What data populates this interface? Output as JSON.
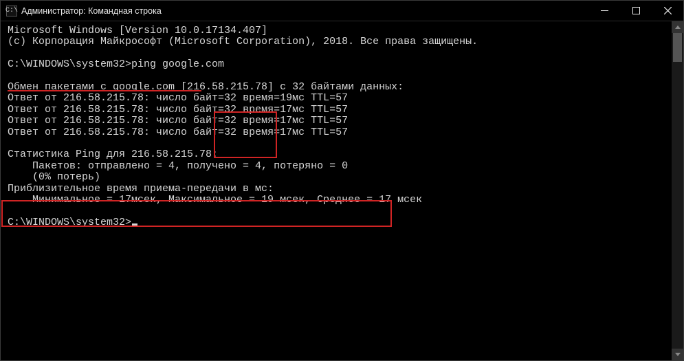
{
  "titlebar": {
    "icon_label": "C:\\",
    "title": "Администратор: Командная строка"
  },
  "window_controls": {
    "minimize": "minimize",
    "maximize": "maximize",
    "close": "close"
  },
  "console": {
    "line_win_version": "Microsoft Windows [Version 10.0.17134.407]",
    "line_copyright": "(c) Корпорация Майкрософт (Microsoft Corporation), 2018. Все права защищены.",
    "prompt1_prefix": "C:\\WINDOWS\\system32>",
    "prompt1_command": "ping google.com",
    "ping_header": "Обмен пакетами с google.com [216.58.215.78] с 32 байтами данных:",
    "replies": [
      {
        "prefix": "Ответ от 216.58.215.78: число байт=32 ",
        "time": "время=19мс",
        "suffix": " TTL=57"
      },
      {
        "prefix": "Ответ от 216.58.215.78: число байт=32 ",
        "time": "время=17мс",
        "suffix": " TTL=57"
      },
      {
        "prefix": "Ответ от 216.58.215.78: число байт=32 ",
        "time": "время=17мс",
        "suffix": " TTL=57"
      },
      {
        "prefix": "Ответ от 216.58.215.78: число байт=32 ",
        "time": "время=17мс",
        "suffix": " TTL=57"
      }
    ],
    "stats_header": "Статистика Ping для 216.58.215.78:",
    "stats_packets": "    Пакетов: отправлено = 4, получено = 4, потеряно = 0",
    "stats_loss": "    (0% потерь)",
    "rtt_header": "Приблизительное время приема-передачи в мс:",
    "rtt_values": "    Минимальное = 17мсек, Максимальное = 19 мсек, Среднее = 17 мсек",
    "prompt2": "C:\\WINDOWS\\system32>"
  },
  "annotations": {
    "underline_color": "#d02424",
    "box_color": "#d02424"
  }
}
